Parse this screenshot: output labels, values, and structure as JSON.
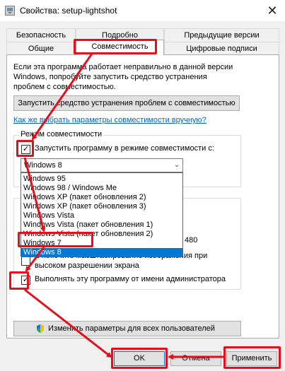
{
  "window": {
    "title": "Свойства: setup-lightshot",
    "close_glyph": "✕"
  },
  "tabs_row_back": [
    "Безопасность",
    "Подробно",
    "Предыдущие версии"
  ],
  "tabs_row_front": [
    "Общие",
    "Совместимость",
    "Цифровые подписи"
  ],
  "intro": {
    "line1": "Если эта программа работает неправильно в данной версии",
    "line2": "Windows, попробуйте запустить средство устранения",
    "line3": "проблем с совместимостью."
  },
  "troubleshoot_button": "Запустить средство устранения проблем с совместимостью",
  "manual_link": "Как же выбрать параметры совместимости вручную?",
  "compat_mode": {
    "group_title": "Режим совместимости",
    "checkbox_label": "Запустить программу в режиме совместимости с:",
    "checked": true,
    "selected": "Windows 8",
    "options": [
      "Windows 95",
      "Windows 98 / Windows Me",
      "Windows XP (пакет обновления 2)",
      "Windows XP (пакет обновления 3)",
      "Windows Vista",
      "Windows Vista (пакет обновления 1)",
      "Windows Vista (пакет обновления 2)",
      "Windows 7",
      "Windows 8"
    ]
  },
  "settings": {
    "resolution_fragment": "480",
    "dpi_line1": "Отключить масштабирование изображения при",
    "dpi_line2": "высоком разрешении экрана",
    "admin_label": "Выполнять эту программу от имени администратора",
    "admin_checked": true
  },
  "all_users_button": "Изменить параметры для всех пользователей",
  "footer": {
    "ok": "OK",
    "cancel": "Отмена",
    "apply": "Применить"
  },
  "colors": {
    "accent": "#0078d7",
    "annotation": "#e2101d",
    "link": "#0066cc"
  },
  "check_glyph": "✓",
  "dropdown_arrow_glyph": "⌄"
}
